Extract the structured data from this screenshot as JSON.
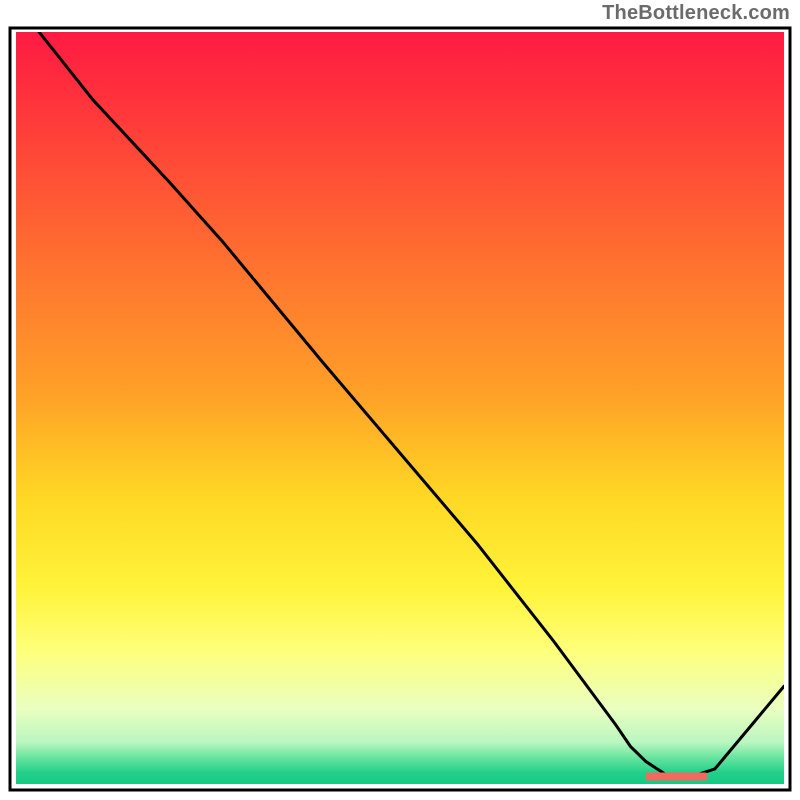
{
  "attribution": "TheBottleneck.com",
  "chart_data": {
    "type": "line",
    "title": "",
    "xlabel": "",
    "ylabel": "",
    "xlim": [
      0,
      100
    ],
    "ylim": [
      0,
      100
    ],
    "grid": false,
    "series": [
      {
        "name": "curve",
        "x": [
          3,
          10,
          20,
          27,
          40,
          50,
          60,
          70,
          78,
          80,
          82,
          85,
          88,
          91,
          100
        ],
        "y": [
          100,
          91,
          80,
          72,
          56,
          44,
          32,
          19,
          8,
          5,
          3,
          1,
          1,
          2,
          13
        ]
      }
    ],
    "flat_segment": {
      "x_start": 82,
      "x_end": 90,
      "color": "#f06a60",
      "label_present": false
    },
    "gradient_stops": [
      {
        "offset": 0.0,
        "color": "#ff1a43"
      },
      {
        "offset": 0.12,
        "color": "#ff3b3a"
      },
      {
        "offset": 0.3,
        "color": "#ff6f30"
      },
      {
        "offset": 0.48,
        "color": "#ffa028"
      },
      {
        "offset": 0.62,
        "color": "#ffd824"
      },
      {
        "offset": 0.74,
        "color": "#fff33a"
      },
      {
        "offset": 0.82,
        "color": "#ffff78"
      },
      {
        "offset": 0.9,
        "color": "#eaffc0"
      },
      {
        "offset": 0.945,
        "color": "#b9f6c0"
      },
      {
        "offset": 0.965,
        "color": "#68e49f"
      },
      {
        "offset": 0.985,
        "color": "#22d08a"
      },
      {
        "offset": 1.0,
        "color": "#17c884"
      }
    ]
  },
  "plot": {
    "outer_x": 10,
    "outer_y": 28,
    "outer_w": 780,
    "outer_h": 762,
    "inner_pad_left": 6,
    "inner_pad_top": 4,
    "inner_pad_right": 6,
    "inner_pad_bottom": 6,
    "border_color": "#000000",
    "border_width": 3,
    "line_color": "#000000",
    "line_width": 3
  }
}
